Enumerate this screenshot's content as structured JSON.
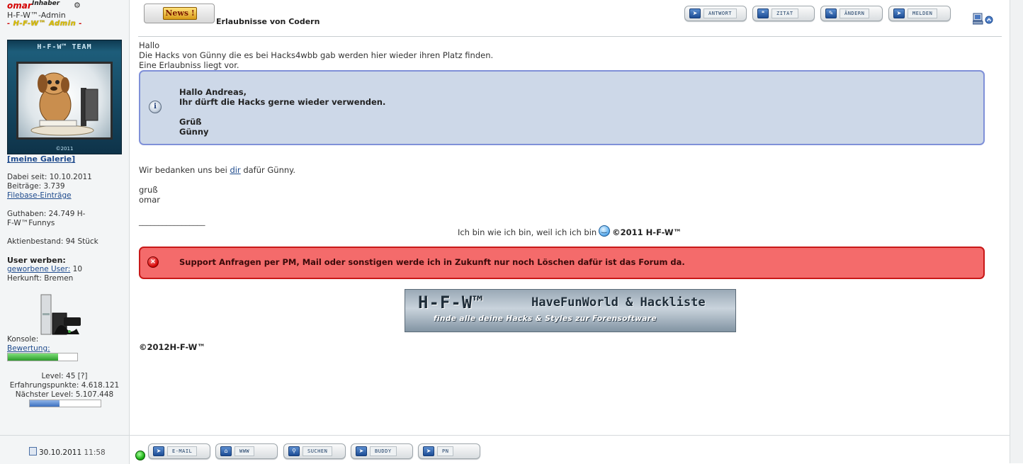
{
  "user": {
    "name": "omar",
    "badge": "Inhaber",
    "rank": "H-F-W™-Admin",
    "title_prefix": "- ",
    "title_main": "H-F-W™ Admin",
    "title_suffix": " -",
    "avatar_header": "H-F-W™ TEAM",
    "avatar_copy": "©2011",
    "gallery_link": "[meine Galerie]",
    "joined": "Dabei seit: 10.10.2011",
    "posts": "Beiträge: 3.739",
    "filebase_link": "Filebase-Einträge",
    "balance": "Guthaben: 24.749 H-F-W™Funnys",
    "shares": "Aktienbestand: 94 Stück",
    "recruit_heading": "User werben:",
    "recruited_link": "geworbene User:",
    "recruited_count": " 10",
    "origin": "Herkunft: Bremen",
    "console_label": "Konsole:",
    "rating_link": "Bewertung:",
    "rating_fill": 0.72,
    "level": "Level: 45 [?]",
    "xp": "Erfahrungspunkte: 4.618.121",
    "next_level": "Nächster Level: 5.107.448",
    "xp_fill": 0.42
  },
  "post": {
    "news_label": "News !",
    "title": "Erlaubnisse von Codern",
    "actions": [
      {
        "label": "ANTWORT",
        "icon": "reply-icon"
      },
      {
        "label": "ZITAT",
        "icon": "quote-icon"
      },
      {
        "label": "ÄNDERN",
        "icon": "edit-icon"
      },
      {
        "label": "MELDEN",
        "icon": "report-icon"
      }
    ],
    "greeting": "Hallo",
    "line1": "Die Hacks von Günny die es bei Hacks4wbb gab werden hier wieder ihren Platz finden.",
    "line2": "Eine Erlaubniss liegt vor.",
    "info": {
      "l1": "Hallo Andreas,",
      "l2": "Ihr dürft die Hacks gerne wieder verwenden.",
      "l3": "Grüß",
      "l4": "Günny"
    },
    "thanks_pre": "Wir bedanken uns bei ",
    "thanks_link": "dir",
    "thanks_post": " dafür Günny.",
    "closing1": "gruß",
    "closing2": "omar",
    "sig_line": "_________________",
    "sig_text": "Ich bin wie ich bin, weil ich ich bin",
    "sig_brand": "©2011 H-F-W™",
    "warning": "Support Anfragen per PM, Mail oder sonstigen werde ich in Zukunft nur noch Löschen dafür ist das Forum da.",
    "banner_big": "H-F-W™",
    "banner_sub": "HaveFunWorld & Hackliste",
    "banner_line": "finde alle deine Hacks & Styles zur Forensoftware",
    "footer_copy": "©2012H-F-W™"
  },
  "footer": {
    "date": "30.10.2011",
    "time": "11:58",
    "buttons": [
      {
        "label": "E-MAIL",
        "icon": "email-icon"
      },
      {
        "label": "WWW",
        "icon": "home-icon"
      },
      {
        "label": "SUCHEN",
        "icon": "search-icon"
      },
      {
        "label": "BUDDY",
        "icon": "buddy-icon"
      },
      {
        "label": "PN",
        "icon": "pm-icon"
      }
    ]
  }
}
